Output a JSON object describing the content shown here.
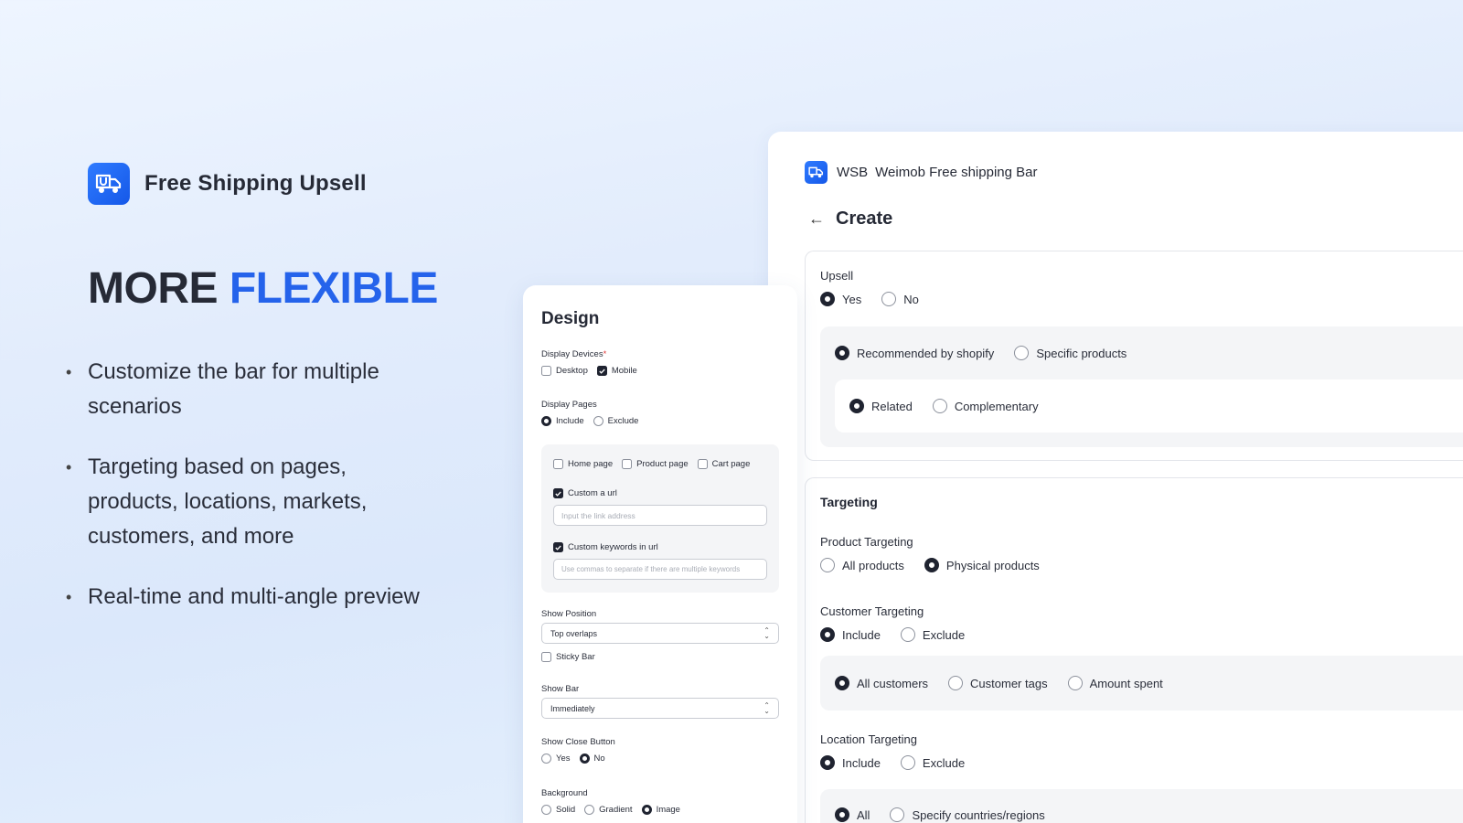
{
  "brand": {
    "name": "Free Shipping Upsell"
  },
  "headline": {
    "dark": "MORE",
    "blue": "FLEXIBLE"
  },
  "bullets": [
    "Customize the bar for multiple scenarios",
    "Targeting based on pages, products, locations, markets, customers, and more",
    "Real-time and multi-angle preview"
  ],
  "create": {
    "app_abbr": "WSB",
    "app_name": "Weimob Free shipping Bar",
    "title": "Create",
    "upsell": {
      "label": "Upsell",
      "options": [
        "Yes",
        "No"
      ],
      "selected": "Yes",
      "source_options": [
        "Recommended by shopify",
        "Specific products"
      ],
      "source_selected": "Recommended by shopify",
      "type_options": [
        "Related",
        "Complementary"
      ],
      "type_selected": "Related"
    },
    "targeting": {
      "title": "Targeting",
      "product": {
        "label": "Product Targeting",
        "options": [
          "All products",
          "Physical products"
        ],
        "selected": "Physical products"
      },
      "customer": {
        "label": "Customer Targeting",
        "options": [
          "Include",
          "Exclude"
        ],
        "selected": "Include",
        "sub_options": [
          "All customers",
          "Customer tags",
          "Amount spent"
        ],
        "sub_selected": "All customers"
      },
      "location": {
        "label": "Location Targeting",
        "options": [
          "Include",
          "Exclude"
        ],
        "selected": "Include",
        "sub_options": [
          "All",
          "Specify countries/regions"
        ],
        "sub_selected": "All"
      }
    }
  },
  "design": {
    "title": "Design",
    "display_devices": {
      "label": "Display Devices",
      "required_mark": "*",
      "options": [
        "Desktop",
        "Mobile"
      ],
      "checked": [
        "Mobile"
      ]
    },
    "display_pages": {
      "label": "Display Pages",
      "options": [
        "Include",
        "Exclude"
      ],
      "selected": "Include",
      "pages": [
        "Home page",
        "Product page",
        "Cart page"
      ],
      "custom_url": {
        "label": "Custom a url",
        "checked": true,
        "placeholder": "Input the link address"
      },
      "custom_keywords": {
        "label": "Custom keywords in url",
        "checked": true,
        "placeholder": "Use commas to separate if there are multiple keywords"
      }
    },
    "show_position": {
      "label": "Show Position",
      "value": "Top overlaps",
      "sticky_label": "Sticky Bar"
    },
    "show_bar": {
      "label": "Show Bar",
      "value": "Immediately"
    },
    "show_close": {
      "label": "Show Close Button",
      "options": [
        "Yes",
        "No"
      ],
      "selected": "No"
    },
    "background": {
      "label": "Background",
      "options": [
        "Solid",
        "Gradient",
        "Image"
      ],
      "selected": "Image"
    }
  }
}
